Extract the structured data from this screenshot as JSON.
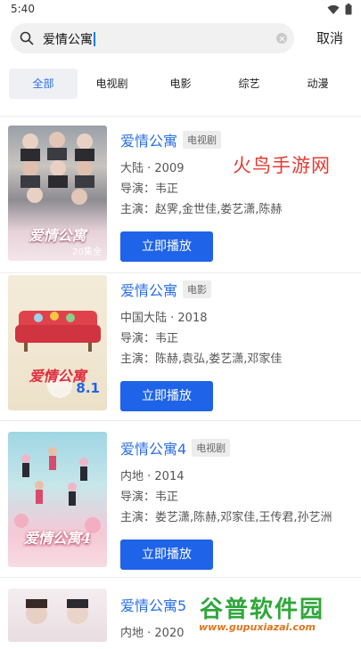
{
  "status": {
    "time": "5:40",
    "icons": [
      "wifi-icon",
      "battery-icon"
    ]
  },
  "search": {
    "query": "爱情公寓",
    "cancel_label": "取消"
  },
  "tabs": [
    "全部",
    "电视剧",
    "电影",
    "综艺",
    "动漫"
  ],
  "active_tab": "全部",
  "colors": {
    "accent": "#1f63e8",
    "title": "#2b6fe6",
    "watermark": "#e53a2f"
  },
  "results": [
    {
      "title": "爱情公寓",
      "badge": "电视剧",
      "region_year": "大陆 · 2009",
      "director": "导演：韦正",
      "cast": "主演：赵霁,金世佳,娄艺潇,陈赫",
      "button": "立即播放",
      "poster_text": "爱情公寓",
      "poster_badge": "20集全"
    },
    {
      "title": "爱情公寓",
      "badge": "电影",
      "region_year": "中国大陆 · 2018",
      "director": "导演：韦正",
      "cast": "主演：陈赫,袁弘,娄艺潇,邓家佳",
      "button": "立即播放",
      "poster_text": "爱情公寓",
      "poster_badge": "8.1"
    },
    {
      "title": "爱情公寓4",
      "badge": "电视剧",
      "region_year": "内地 · 2014",
      "director": "导演：韦正",
      "cast": "主演：娄艺潇,陈赫,邓家佳,王传君,孙艺洲",
      "button": "立即播放",
      "poster_text": "爱情公寓4",
      "poster_badge": ""
    },
    {
      "title": "爱情公寓5",
      "badge": "",
      "region_year": "内地 · 2020",
      "director": "",
      "cast": "",
      "button": "",
      "poster_text": "",
      "poster_badge": ""
    }
  ],
  "watermarks": {
    "top": "火鸟手游网",
    "bottom_cn": "谷普软件园",
    "bottom_url": "www.gupuxiazai.com"
  }
}
